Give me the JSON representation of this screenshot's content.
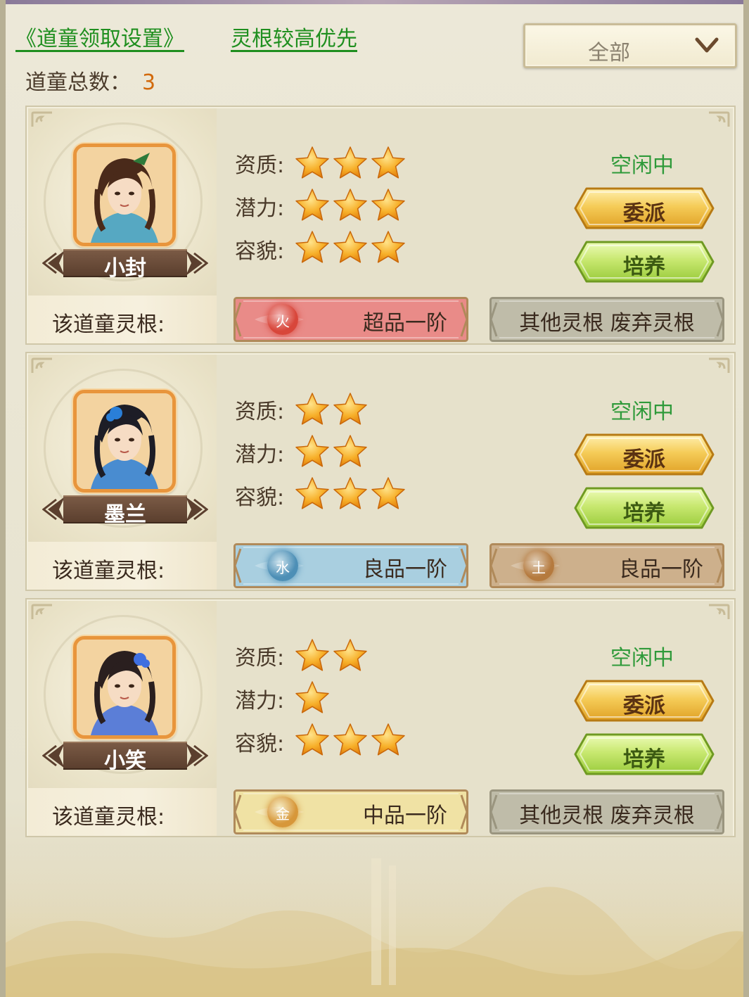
{
  "header": {
    "settings_link": "《道童领取设置》",
    "priority_link": "灵根较高优先",
    "total_label": "道童总数：",
    "total_value": "3",
    "filter": {
      "selected": "全部",
      "icon": "chevron-down-icon"
    }
  },
  "labels": {
    "aptitude": "资质:",
    "potential": "潜力:",
    "appearance": "容貌:",
    "spirit_root": "该道童灵根:",
    "assign": "委派",
    "train": "培养"
  },
  "disciples": [
    {
      "name": "小封",
      "status": "空闲中",
      "aptitude_stars": 3,
      "potential_stars": 3,
      "appearance_stars": 3,
      "roots": [
        {
          "element": "火",
          "grade": "超品一阶",
          "color": "#e98b88"
        },
        {
          "text": "其他灵根 废弃灵根",
          "color": "#bfbca9"
        }
      ]
    },
    {
      "name": "墨兰",
      "status": "空闲中",
      "aptitude_stars": 2,
      "potential_stars": 2,
      "appearance_stars": 3,
      "roots": [
        {
          "element": "水",
          "grade": "良品一阶",
          "color": "#a9cfe0"
        },
        {
          "element": "土",
          "grade": "良品一阶",
          "color": "#cdb08c"
        }
      ]
    },
    {
      "name": "小笑",
      "status": "空闲中",
      "aptitude_stars": 2,
      "potential_stars": 1,
      "appearance_stars": 3,
      "roots": [
        {
          "element": "金",
          "grade": "中品一阶",
          "color": "#f0e2a4"
        },
        {
          "text": "其他灵根 废弃灵根",
          "color": "#bfbca9"
        }
      ]
    }
  ],
  "colors": {
    "status_green": "#2f9a3a",
    "link_green": "#1f8f1f",
    "total_orange": "#d26a0c",
    "portrait_border": "#e8953c"
  }
}
